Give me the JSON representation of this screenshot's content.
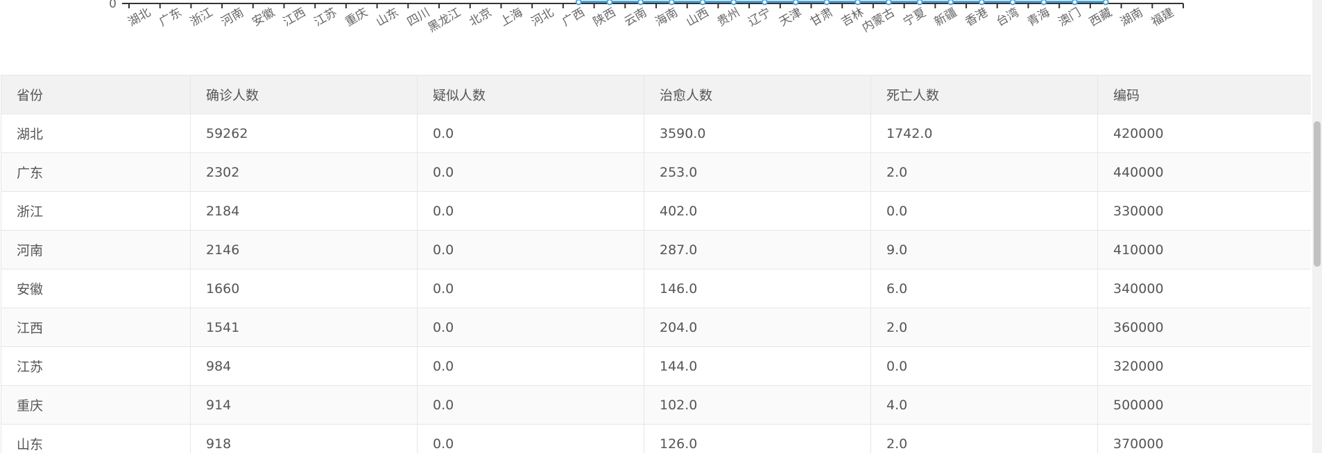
{
  "chart_data": {
    "type": "line",
    "y_axis_visible_tick": "0",
    "categories": [
      "湖北",
      "广东",
      "浙江",
      "河南",
      "安徽",
      "江西",
      "江苏",
      "重庆",
      "山东",
      "四川",
      "黑龙江",
      "北京",
      "上海",
      "河北",
      "广西",
      "陕西",
      "云南",
      "海南",
      "山西",
      "贵州",
      "辽宁",
      "天津",
      "甘肃",
      "吉林",
      "内蒙古",
      "宁夏",
      "新疆",
      "香港",
      "台湾",
      "青海",
      "澳门",
      "西藏",
      "湖南",
      "福建"
    ],
    "colors": {
      "axis": "#333333",
      "series": "#4aa3d6",
      "point_fill": "#ffffff"
    }
  },
  "table": {
    "headers": [
      "省份",
      "确诊人数",
      "疑似人数",
      "治愈人数",
      "死亡人数",
      "编码"
    ],
    "rows": [
      [
        "湖北",
        "59262",
        "0.0",
        "3590.0",
        "1742.0",
        "420000"
      ],
      [
        "广东",
        "2302",
        "0.0",
        "253.0",
        "2.0",
        "440000"
      ],
      [
        "浙江",
        "2184",
        "0.0",
        "402.0",
        "0.0",
        "330000"
      ],
      [
        "河南",
        "2146",
        "0.0",
        "287.0",
        "9.0",
        "410000"
      ],
      [
        "安徽",
        "1660",
        "0.0",
        "146.0",
        "6.0",
        "340000"
      ],
      [
        "江西",
        "1541",
        "0.0",
        "204.0",
        "2.0",
        "360000"
      ],
      [
        "江苏",
        "984",
        "0.0",
        "144.0",
        "0.0",
        "320000"
      ],
      [
        "重庆",
        "914",
        "0.0",
        "102.0",
        "4.0",
        "500000"
      ],
      [
        "山东",
        "918",
        "0.0",
        "126.0",
        "2.0",
        "370000"
      ]
    ]
  }
}
